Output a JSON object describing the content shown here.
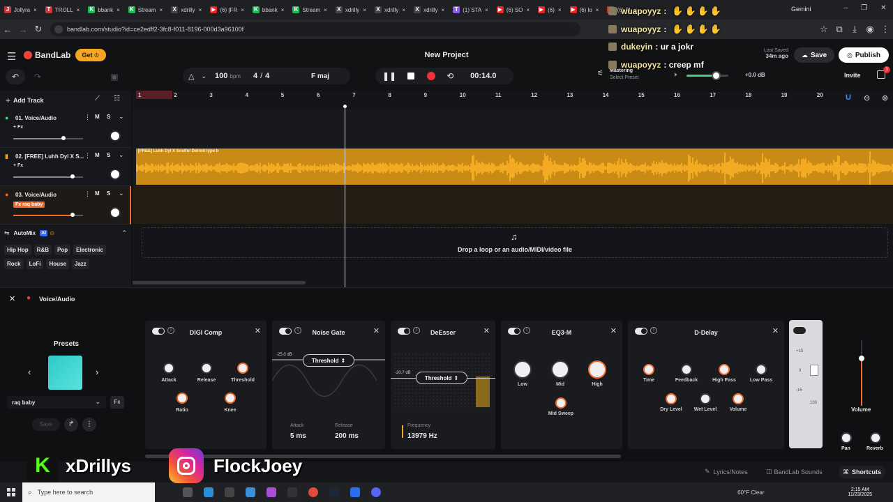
{
  "browser": {
    "tabs": [
      {
        "label": "Jollyra",
        "color": "#c23a3a",
        "glyph": "J"
      },
      {
        "label": "TROLL",
        "color": "#c23a3a",
        "glyph": "T"
      },
      {
        "label": "bbank",
        "color": "#1db954",
        "glyph": "K"
      },
      {
        "label": "Stream",
        "color": "#1db954",
        "glyph": "K"
      },
      {
        "label": "xdrilly",
        "color": "#444",
        "glyph": "X"
      },
      {
        "label": "(6) [FR",
        "color": "#e22",
        "glyph": "▶"
      },
      {
        "label": "bbank",
        "color": "#1db954",
        "glyph": "K"
      },
      {
        "label": "Stream",
        "color": "#1db954",
        "glyph": "K"
      },
      {
        "label": "xdrilly",
        "color": "#444",
        "glyph": "X"
      },
      {
        "label": "xdrilly",
        "color": "#444",
        "glyph": "X"
      },
      {
        "label": "xdrilly",
        "color": "#444",
        "glyph": "X"
      },
      {
        "label": "(1) STA",
        "color": "#8a5cf0",
        "glyph": "T"
      },
      {
        "label": "(6) SO",
        "color": "#e22",
        "glyph": "▶"
      },
      {
        "label": "(6)",
        "color": "#e22",
        "glyph": "▶"
      },
      {
        "label": "(6) lo",
        "color": "#e22",
        "glyph": "▶"
      },
      {
        "label": "(6) Pl",
        "color": "#e22",
        "glyph": "▶"
      }
    ],
    "gemini_label": "Gemini",
    "url": "bandlab.com/studio?id=ce2edff2-3fc8-f011-8196-000d3a96100f"
  },
  "app": {
    "logo": "BandLab",
    "get_label": "Get",
    "project_title": "New Project",
    "last_saved_label": "Last Saved",
    "last_saved_time": "34m ago",
    "save_label": "Save",
    "publish_label": "Publish",
    "invite_label": "Invite",
    "invite_badge": "3",
    "bpm": "100",
    "bpm_unit": "bpm",
    "time_sig_num": "4",
    "time_sig_den": "4",
    "key": "F maj",
    "time": "00:14.0",
    "mastering_label": "Mastering",
    "mastering_preset": "Select Preset",
    "master_db": "+0.0 dB"
  },
  "tracks": {
    "add_track": "Add Track",
    "items": [
      {
        "name": "01. Voice/Audio",
        "fx": "+ Fx",
        "type": "voice",
        "fader": 0.72
      },
      {
        "name": "02. [FREE] Luhh Dyl X S...",
        "fx": "+ Fx",
        "type": "audio",
        "fader": 0.85
      },
      {
        "name": "03. Voice/Audio",
        "fx": "Fx raq baby",
        "type": "voice",
        "fader": 0.85
      }
    ],
    "mute": "M",
    "solo": "S",
    "automix_label": "AutoMix",
    "ai_badge": "AI",
    "genres": [
      "Hip Hop",
      "R&B",
      "Pop",
      "Electronic",
      "Rock",
      "LoFi",
      "House",
      "Jazz"
    ]
  },
  "arrange": {
    "ruler": [
      "1",
      "2",
      "3",
      "4",
      "5",
      "6",
      "7",
      "8",
      "9",
      "10",
      "11",
      "12",
      "13",
      "14",
      "15",
      "16",
      "17",
      "18",
      "19",
      "20"
    ],
    "clip_label": "[FREE] Luhh Dyl X Soulful Detroit type b",
    "drop_text": "Drop a loop or an audio/MIDI/video file",
    "playhead_bar": 7
  },
  "fx": {
    "track_label": "Voice/Audio",
    "presets_label": "Presets",
    "preset_name": "raq baby",
    "save_label": "Save",
    "plugins": {
      "comp": {
        "title": "DIGI Comp",
        "knobs": [
          "Attack",
          "Release",
          "Threshold",
          "Ratio",
          "Knee"
        ]
      },
      "gate": {
        "title": "Noise Gate",
        "level": "-25.0 dB",
        "threshold_label": "Threshold",
        "attack_label": "Attack",
        "attack_val": "5 ms",
        "release_label": "Release",
        "release_val": "200 ms"
      },
      "deesser": {
        "title": "DeEsser",
        "level": "-20.7 dB",
        "threshold_label": "Threshold",
        "freq_label": "Frequency",
        "freq_val": "13979 Hz"
      },
      "eq": {
        "title": "EQ3-M",
        "knobs": [
          "Low",
          "Mid",
          "High",
          "Mid Sweep"
        ]
      },
      "delay": {
        "title": "D-Delay",
        "knobs": [
          "Time",
          "Feedback",
          "High Pass",
          "Low Pass",
          "Dry Level",
          "Wet Level",
          "Volume"
        ]
      }
    },
    "meter_ticks": [
      "+15",
      "0",
      "-15",
      "100"
    ],
    "volume_label": "Volume",
    "pan_label": "Pan",
    "reverb_label": "Reverb"
  },
  "bottom": {
    "lyrics_label": "Lyrics/Notes",
    "sounds_label": "BandLab Sounds",
    "shortcuts_label": "Shortcuts"
  },
  "overlay": {
    "chat": [
      {
        "name": "wuapoyyz",
        "msg": ":"
      },
      {
        "name": "wuapoyyz",
        "msg": ":"
      },
      {
        "name": "dukeyin",
        "msg": ": ur a jokr"
      },
      {
        "name": "wuapoyyz",
        "msg": ": creep mf"
      }
    ],
    "kick_handle": "xDrillys",
    "ig_handle": "FlockJoey"
  },
  "taskbar": {
    "search_placeholder": "Type here to search",
    "weather": "60°F Clear",
    "time": "2:15 AM",
    "date": "11/23/2025"
  }
}
